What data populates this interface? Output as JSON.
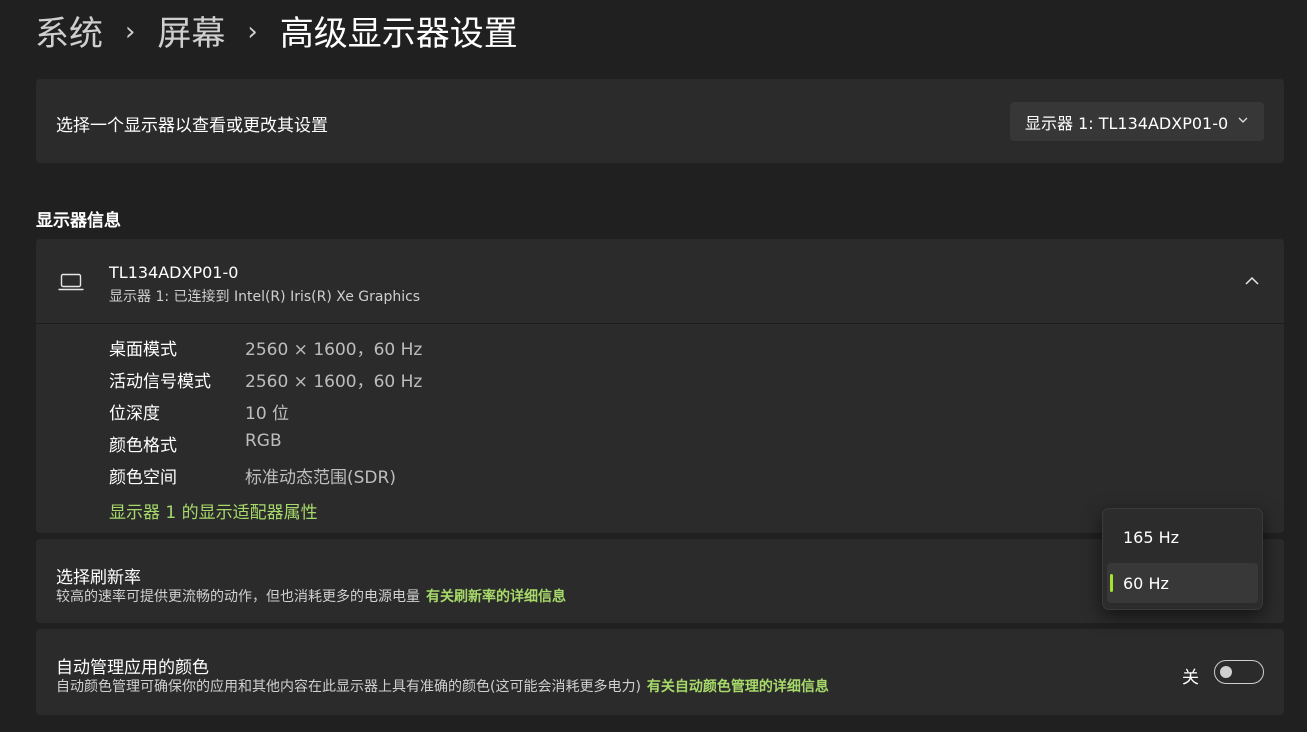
{
  "breadcrumb": {
    "items": [
      "系统",
      "屏幕"
    ],
    "current": "高级显示器设置",
    "separator": "›"
  },
  "display_select": {
    "label": "选择一个显示器以查看或更改其设置",
    "value": "显示器 1: TL134ADXP01-0"
  },
  "display_info": {
    "section_title": "显示器信息",
    "name": "TL134ADXP01-0",
    "subtitle": "显示器 1: 已连接到 Intel(R) Iris(R) Xe Graphics",
    "rows": [
      {
        "key": "桌面模式",
        "value": "2560 × 1600，60 Hz"
      },
      {
        "key": "活动信号模式",
        "value": "2560 × 1600，60 Hz"
      },
      {
        "key": "位深度",
        "value": "10 位"
      },
      {
        "key": "颜色格式",
        "value": "RGB"
      },
      {
        "key": "颜色空间",
        "value": "标准动态范围(SDR)"
      }
    ],
    "adapter_link": "显示器 1 的显示适配器属性"
  },
  "refresh_rate": {
    "title": "选择刷新率",
    "description": "较高的速率可提供更流畅的动作，但也消耗更多的电源电量",
    "link": "有关刷新率的详细信息",
    "options": [
      "165 Hz",
      "60 Hz"
    ],
    "selected": "60 Hz"
  },
  "auto_color": {
    "title": "自动管理应用的颜色",
    "description": "自动颜色管理可确保你的应用和其他内容在此显示器上具有准确的颜色(这可能会消耗更多电力)",
    "link": "有关自动颜色管理的详细信息",
    "toggle_label": "关",
    "toggle_on": false
  },
  "colors": {
    "background": "#202020",
    "card": "#2b2b2b",
    "accent": "#a6d96a",
    "indicator": "#a6e22e"
  }
}
